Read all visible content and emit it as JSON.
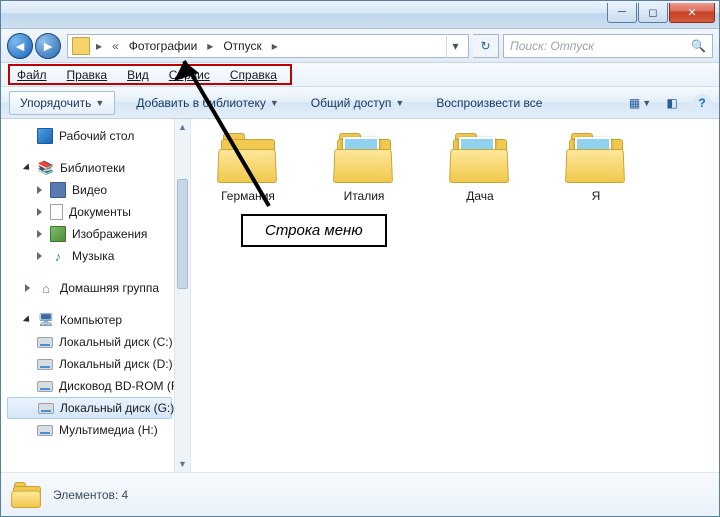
{
  "breadcrumb": {
    "seg1": "Фотографии",
    "seg2": "Отпуск"
  },
  "search": {
    "placeholder": "Поиск: Отпуск"
  },
  "menubar": {
    "file": "Файл",
    "edit": "Правка",
    "view": "Вид",
    "service": "Сервис",
    "help": "Справка"
  },
  "toolbar": {
    "organize": "Упорядочить",
    "add_library": "Добавить в библиотеку",
    "share": "Общий доступ",
    "play_all": "Воспроизвести все"
  },
  "sidebar": {
    "desktop": "Рабочий стол",
    "libraries": "Библиотеки",
    "videos": "Видео",
    "documents": "Документы",
    "pictures": "Изображения",
    "music": "Музыка",
    "homegroup": "Домашняя группа",
    "computer": "Компьютер",
    "drive_c": "Локальный диск (C:)",
    "drive_d": "Локальный диск (D:)",
    "drive_f": "Дисковод BD-ROM (F:)",
    "drive_g": "Локальный диск (G:)",
    "drive_h": "Мультимедиа (H:)"
  },
  "items": {
    "i0": "Германия",
    "i1": "Италия",
    "i2": "Дача",
    "i3": "Я"
  },
  "status": {
    "label": "Элементов: 4"
  },
  "annotation": {
    "label": "Строка меню"
  }
}
